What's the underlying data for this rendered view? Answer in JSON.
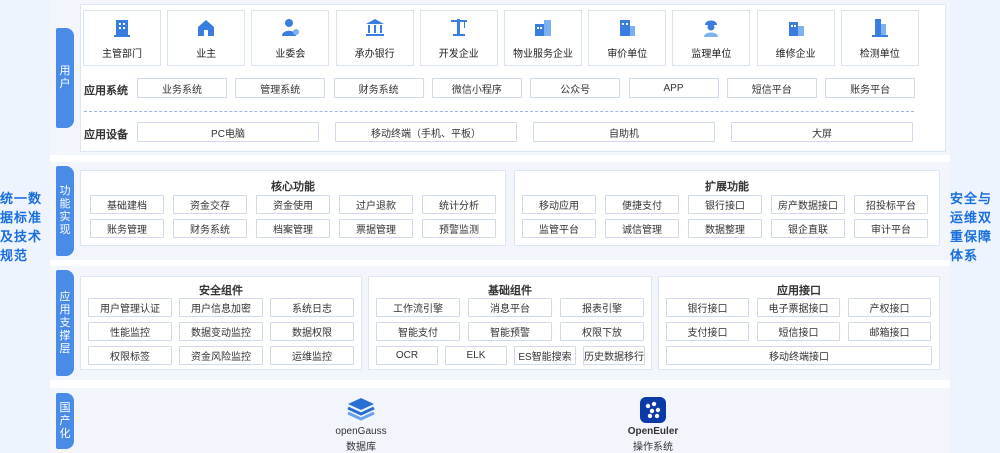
{
  "left_side": {
    "label": "统一数据标准及技术规范"
  },
  "right_side": {
    "label": "安全与运维双重保障体系"
  },
  "layers": {
    "users": "用户",
    "functions": "功能实现",
    "support": "应用支撑层",
    "domestic": "国产化"
  },
  "users": {
    "tiles": [
      {
        "label": "主管部门",
        "icon": "building-icon"
      },
      {
        "label": "业主",
        "icon": "home-icon"
      },
      {
        "label": "业委会",
        "icon": "user-gear-icon"
      },
      {
        "label": "承办银行",
        "icon": "bank-icon"
      },
      {
        "label": "开发企业",
        "icon": "crane-icon"
      },
      {
        "label": "物业服务企业",
        "icon": "property-icon"
      },
      {
        "label": "审价单位",
        "icon": "office-icon"
      },
      {
        "label": "监理单位",
        "icon": "worker-icon"
      },
      {
        "label": "维修企业",
        "icon": "repair-building-icon"
      },
      {
        "label": "检测单位",
        "icon": "tower-icon"
      }
    ],
    "systems_label": "应用系统",
    "systems": [
      "业务系统",
      "管理系统",
      "财务系统",
      "微信小程序",
      "公众号",
      "APP",
      "短信平台",
      "账务平台"
    ],
    "devices_label": "应用设备",
    "devices": [
      "PC电脑",
      "移动终端（手机、平板）",
      "自助机",
      "大屏"
    ]
  },
  "functions": {
    "core": {
      "title": "核心功能",
      "items": [
        "基础建档",
        "资金交存",
        "资金使用",
        "过户退款",
        "统计分析",
        "账务管理",
        "财务系统",
        "档案管理",
        "票据管理",
        "预警监测"
      ]
    },
    "extended": {
      "title": "扩展功能",
      "items": [
        "移动应用",
        "便捷支付",
        "银行接口",
        "房产数据接口",
        "招投标平台",
        "监管平台",
        "诚信管理",
        "数据整理",
        "银企直联",
        "审计平台"
      ]
    }
  },
  "support": {
    "security": {
      "title": "安全组件",
      "items": [
        "用户管理认证",
        "用户信息加密",
        "系统日志",
        "性能监控",
        "数据变动监控",
        "数据权限",
        "权限标签",
        "资金风险监控",
        "运维监控"
      ]
    },
    "basic": {
      "title": "基础组件",
      "items": [
        "工作流引擎",
        "消息平台",
        "报表引擎",
        "智能支付",
        "智能预警",
        "权限下放",
        "OCR",
        "ELK",
        "ES智能搜索",
        "历史数据移行"
      ]
    },
    "interface": {
      "title": "应用接口",
      "items": [
        "银行接口",
        "电子票据接口",
        "产权接口",
        "支付接口",
        "短信接口",
        "邮箱接口",
        "移动终端接口"
      ]
    }
  },
  "domestic": {
    "gauss_name": "openGauss",
    "gauss_caption": "数据库",
    "euler_name": "OpenEuler",
    "euler_caption": "操作系统"
  },
  "colors": {
    "accent": "#1a6fe0",
    "tab": "#4b8be8",
    "band": "#f2f6fc"
  }
}
